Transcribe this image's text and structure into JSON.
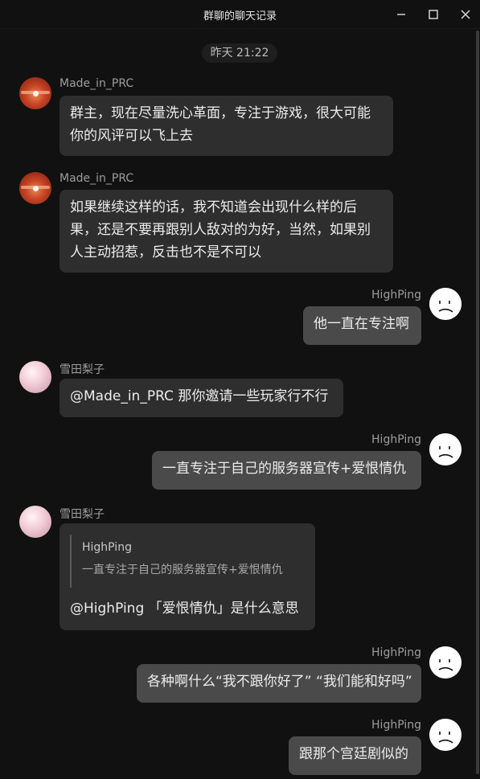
{
  "window": {
    "title": "群聊的聊天记录",
    "controls": [
      "minimize-icon",
      "maximize-icon",
      "close-icon"
    ]
  },
  "timestamp": "昨天 21:22",
  "messages": [
    {
      "sender": "Made_in_PRC",
      "avatar": "avatar-made-in-prc",
      "side": "left",
      "lines": [
        "群主，现在尽量洗心革面，专注于游戏，很大可能",
        "你的风评可以飞上去"
      ]
    },
    {
      "sender": "Made_in_PRC",
      "avatar": "avatar-made-in-prc",
      "side": "left",
      "lines": [
        "如果继续这样的话，我不知道会出现什么样的后",
        "果，还是不要再跟别人敌对的为好，当然，如果别",
        "人主动招惹，反击也不是不可以"
      ]
    },
    {
      "sender": "HighPing",
      "avatar": "avatar-highping",
      "side": "right",
      "lines": [
        "他一直在专注啊"
      ]
    },
    {
      "sender": "雪田梨子",
      "avatar": "avatar-yukita-riko",
      "side": "left",
      "lines": [
        "@Made_in_PRC 那你邀请一些玩家行不行"
      ]
    },
    {
      "sender": "HighPing",
      "avatar": "avatar-highping",
      "side": "right",
      "lines": [
        "一直专注于自己的服务器宣传+爱恨情仇"
      ]
    },
    {
      "sender": "雪田梨子",
      "avatar": "avatar-yukita-riko",
      "side": "left",
      "quote": {
        "sender": "HighPing",
        "text": "一直专注于自己的服务器宣传+爱恨情仇"
      },
      "lines": [
        "@HighPing 「爱恨情仇」是什么意思"
      ]
    },
    {
      "sender": "HighPing",
      "avatar": "avatar-highping",
      "side": "right",
      "lines": [
        "各种啊什么“我不跟你好了” “我们能和好吗”"
      ]
    },
    {
      "sender": "HighPing",
      "avatar": "avatar-highping",
      "side": "right",
      "lines": [
        "跟那个宫廷剧似的"
      ]
    }
  ],
  "colors": {
    "background": "#111111",
    "bubble_left": "#2e2e2e",
    "bubble_right": "#4a4a4a",
    "sender_text": "#9d9d9d"
  }
}
